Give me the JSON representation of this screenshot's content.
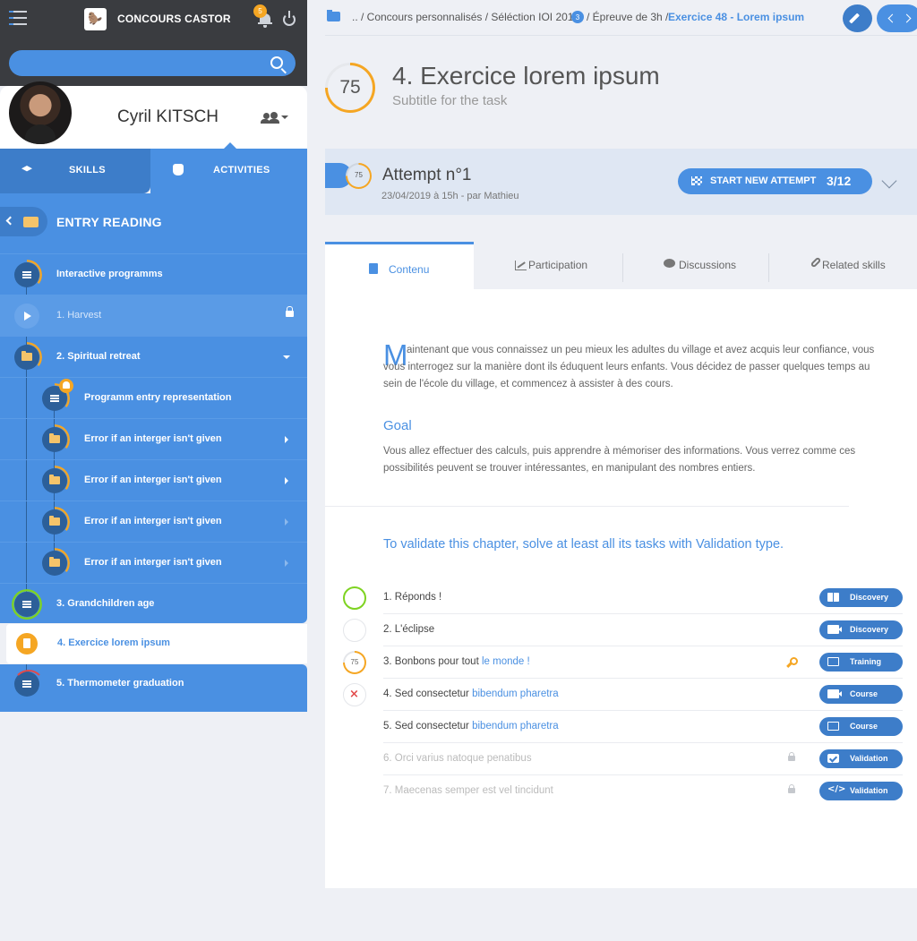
{
  "app": {
    "title": "CONCOURS CASTOR",
    "notification_count": "5"
  },
  "search": {
    "placeholder": ""
  },
  "profile": {
    "name": "Cyril KITSCH"
  },
  "tabs": {
    "skills": "SKILLS",
    "activities": "ACTIVITIES"
  },
  "tree": {
    "header": "ENTRY READING",
    "items": [
      {
        "label": "Interactive programms"
      },
      {
        "label": "1. Harvest"
      },
      {
        "label": "2. Spiritual retreat"
      },
      {
        "label": "Programm entry representation"
      },
      {
        "label": "Error if an interger isn't given"
      },
      {
        "label": "Error if an interger isn't given"
      },
      {
        "label": "Error if an interger isn't given"
      },
      {
        "label": "Error if an interger isn't given"
      },
      {
        "label": "3. Grandchildren age"
      },
      {
        "label": "4. Exercice lorem ipsum"
      },
      {
        "label": "5. Thermometer graduation"
      }
    ]
  },
  "breadcrumb": {
    "part1": ".. / Concours personnalisés / Séléction IOI 2012",
    "badge": "3",
    "part2": "/ Épreuve de 3h /",
    "current": "Exercice 48 - Lorem ipsum"
  },
  "task": {
    "score": "75",
    "title": "4. Exercice lorem ipsum",
    "subtitle": "Subtitle for the task"
  },
  "attempt": {
    "score": "75",
    "title": "Attempt n°1",
    "subtitle": "23/04/2019 à 15h - par Mathieu",
    "button": "START NEW ATTEMPT",
    "count": "3/12"
  },
  "content_tabs": {
    "contenu": "Contenu",
    "participation": "Participation",
    "discussions": "Discussions",
    "related": "Related skills"
  },
  "content": {
    "dropcap": "M",
    "para1": "aintenant que vous connaissez un peu mieux les adultes du village et avez acquis leur confiance, vous vous interrogez sur la manière dont ils éduquent leurs enfants. Vous décidez de passer quelques temps au sein de l'école du village, et commencez à assister à des cours.",
    "goal_title": "Goal",
    "para2": "Vous allez effectuer des calculs, puis apprendre à mémoriser des informations. Vous verrez comme ces possibilités peuvent se trouver intéressantes, en manipulant des nombres entiers.",
    "validate": "To validate this chapter, solve at least all its tasks with Validation type."
  },
  "tasks": [
    {
      "label": "1. Réponds !",
      "type": "Discovery"
    },
    {
      "label": "2. L'éclipse",
      "type": "Discovery"
    },
    {
      "label_a": "3. Bonbons pour tout ",
      "label_b": "le monde !",
      "score": "75",
      "type": "Training"
    },
    {
      "label_a": "4. Sed consectetur ",
      "label_b": "bibendum pharetra",
      "type": "Course"
    },
    {
      "label_a": "5. Sed consectetur ",
      "label_b": "bibendum pharetra",
      "type": "Course"
    },
    {
      "label": "6. Orci varius natoque penatibus",
      "type": "Validation"
    },
    {
      "label": "7. Maecenas semper est vel tincidunt",
      "type": "Validation"
    }
  ],
  "colors": {
    "accent": "#4a90e2",
    "accent_dark": "#3d7dc9",
    "topbar": "#3a3c40",
    "progress": "#f5a623",
    "success": "#7ed321",
    "fail": "#e24a4a"
  },
  "icons": [
    "hamburger-icon",
    "bell-icon",
    "power-icon",
    "search-icon",
    "group-icon",
    "graduation-cap-icon",
    "hand-icon",
    "folder-icon",
    "list-icon",
    "play-icon",
    "lock-icon",
    "pencil-icon",
    "flag-icon",
    "book-icon",
    "chart-icon",
    "comment-icon",
    "link-icon",
    "key-icon",
    "video-icon",
    "screen-icon",
    "checkbox-icon",
    "code-icon"
  ]
}
